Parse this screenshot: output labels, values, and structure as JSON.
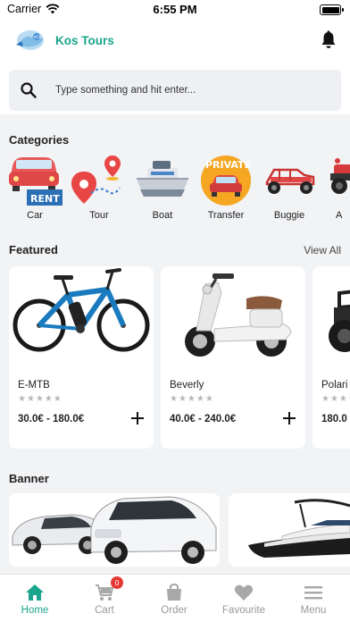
{
  "status_bar": {
    "carrier": "Carrier",
    "time": "6:55 PM"
  },
  "header": {
    "title": "Kos Tours"
  },
  "search": {
    "placeholder": "Type something and hit enter..."
  },
  "categories": {
    "title": "Categories",
    "items": [
      {
        "label": "Car",
        "icon": "car-rental-icon"
      },
      {
        "label": "Tour",
        "icon": "map-pin-tour-icon"
      },
      {
        "label": "Boat",
        "icon": "boat-icon"
      },
      {
        "label": "Transfer",
        "icon": "private-transfer-icon"
      },
      {
        "label": "Buggie",
        "icon": "buggy-icon"
      },
      {
        "label": "A",
        "icon": "atv-icon"
      }
    ]
  },
  "featured": {
    "title": "Featured",
    "view_all": "View All",
    "items": [
      {
        "name": "E-MTB",
        "rating": 0,
        "price": "30.0€ - 180.0€"
      },
      {
        "name": "Beverly",
        "rating": 0,
        "price": "40.0€ - 240.0€"
      },
      {
        "name": "Polari",
        "rating": 0,
        "price": "180.0"
      }
    ]
  },
  "banner": {
    "title": "Banner"
  },
  "bottom_nav": {
    "items": [
      {
        "label": "Home",
        "active": true
      },
      {
        "label": "Cart",
        "badge": "0"
      },
      {
        "label": "Order"
      },
      {
        "label": "Favourite"
      },
      {
        "label": "Menu"
      }
    ]
  },
  "colors": {
    "accent": "#1aa58c",
    "badge": "#e53935",
    "background": "#f2f3f5"
  }
}
